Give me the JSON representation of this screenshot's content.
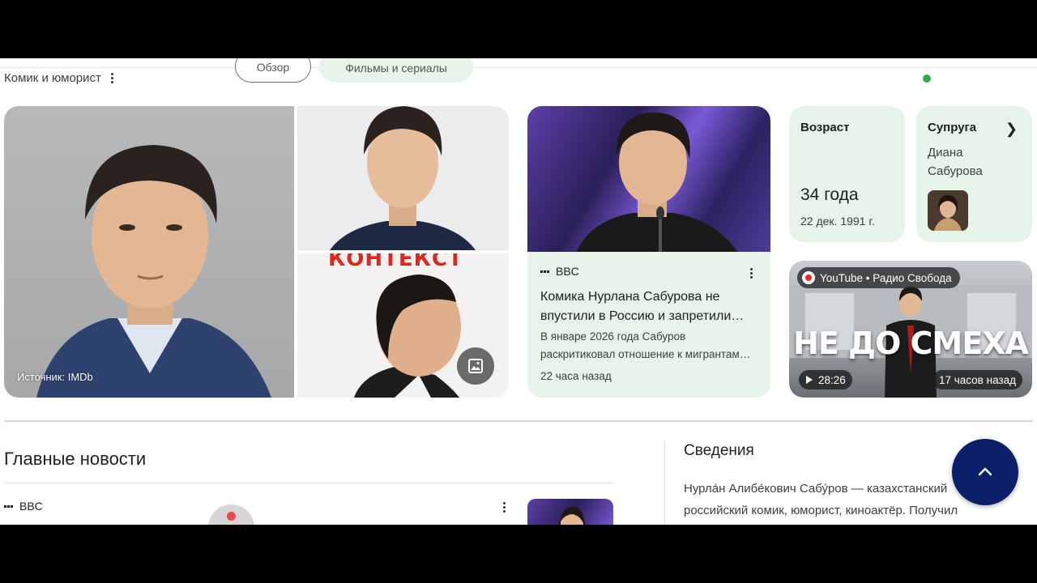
{
  "header": {
    "subtitle": "Комик и юморист",
    "chips": [
      "Обзор",
      "Фильмы и сериалы"
    ]
  },
  "images": {
    "source_label": "Источник: IMDb",
    "magazine_title": "КОНТЕКСТ"
  },
  "news_card": {
    "source": "BBC",
    "title": "Комика Нурлана Сабурова не впустили в Россию и запретили…",
    "snippet": "В январе 2026 года Сабуров раскритиковал отношение к мигрантам…",
    "time": "22 часа назад"
  },
  "facts": {
    "age": {
      "label": "Возраст",
      "value": "34 года",
      "date": "22 дек. 1991 г."
    },
    "spouse": {
      "label": "Супруга",
      "name": "Диана Сабурова"
    }
  },
  "video_card": {
    "source": "YouTube • Радио Свобода",
    "caption": "НЕ ДО СМЕХА",
    "duration": "28:26",
    "time": "17 часов назад"
  },
  "top_news": {
    "title": "Главные новости",
    "first_source": "BBC"
  },
  "info": {
    "title": "Сведения",
    "text": "Нурла́н Алибе́кович Сабу́ров — казахстанский российский комик, юморист, киноактёр. Получил"
  },
  "colors": {
    "card_bg": "#e6f4ea",
    "scroll_button": "#0b1f6b",
    "status_dot": "#34a853"
  }
}
